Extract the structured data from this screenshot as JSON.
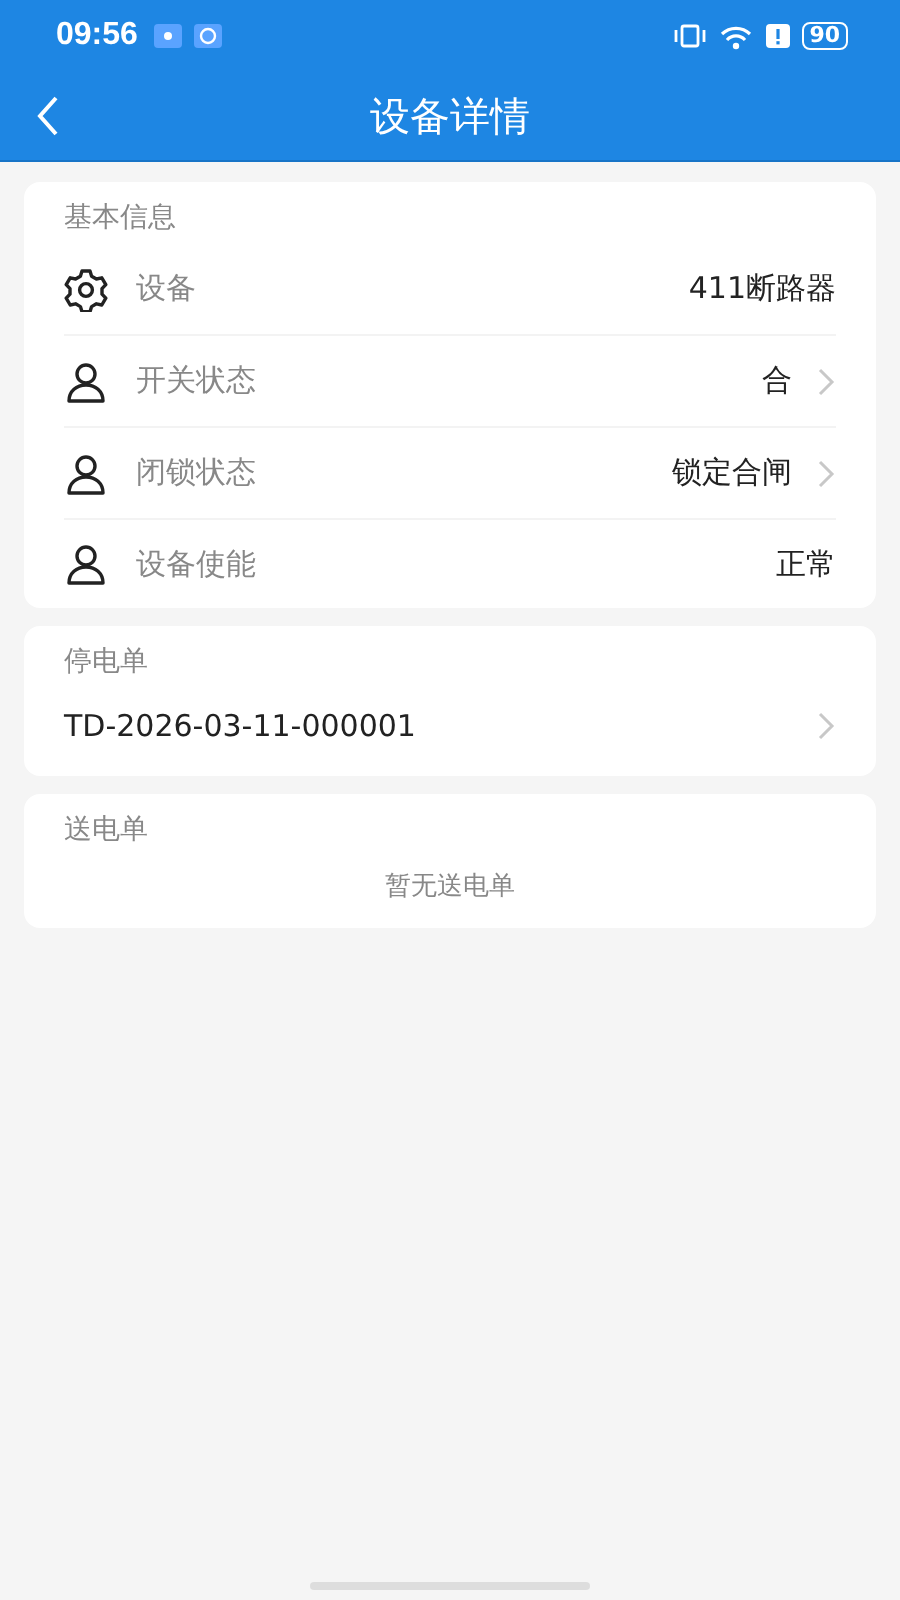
{
  "status_bar": {
    "time": "09:56",
    "battery": "90"
  },
  "header": {
    "title": "设备详情"
  },
  "basic_info": {
    "title": "基本信息",
    "rows": [
      {
        "kind": "gear",
        "label": "设备",
        "value": "411断路器",
        "has_arrow": false
      },
      {
        "kind": "person",
        "label": "开关状态",
        "value": "合",
        "has_arrow": true
      },
      {
        "kind": "person",
        "label": "闭锁状态",
        "value": "锁定合闸",
        "has_arrow": true
      },
      {
        "kind": "person",
        "label": "设备使能",
        "value": "正常",
        "has_arrow": false
      }
    ]
  },
  "outage_orders": {
    "title": "停电单",
    "items": [
      {
        "number": "TD-2026-03-11-000001"
      }
    ]
  },
  "restore_orders": {
    "title": "送电单",
    "empty_text": "暂无送电单"
  }
}
